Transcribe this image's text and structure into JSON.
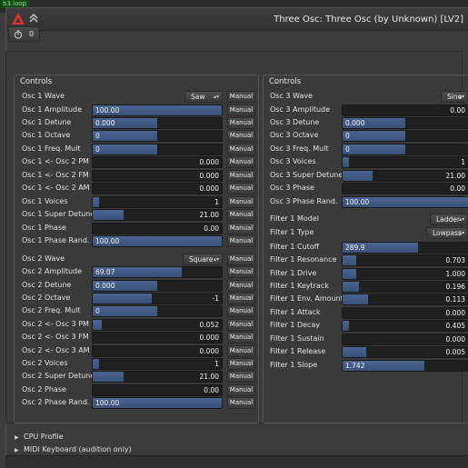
{
  "bg_tab": "b3.loop",
  "window": {
    "title": "Three Osc: Three Osc (by Unknown) [LV2]"
  },
  "preset": {
    "count": "0"
  },
  "panels": {
    "left_title": "Controls",
    "right_title": "Controls"
  },
  "manual_label": "Manual",
  "left": {
    "osc1_wave": {
      "label": "Osc 1 Wave",
      "value": "Saw"
    },
    "osc1_amplitude": {
      "label": "Osc 1 Amplitude",
      "value": "100.00",
      "fraction": 1.0
    },
    "osc1_detune": {
      "label": "Osc 1 Detune",
      "value": "0.000",
      "fraction": 0.5
    },
    "osc1_octave": {
      "label": "Osc 1 Octave",
      "value": "0",
      "fraction": 0.5
    },
    "osc1_freq_mult": {
      "label": "Osc 1 Freq. Mult",
      "value": "0",
      "fraction": 0.5
    },
    "osc1_osc2_pm": {
      "label": "Osc 1 <- Osc 2 PM",
      "value": "0.000",
      "fraction": 0.0
    },
    "osc1_osc2_fm": {
      "label": "Osc 1 <- Osc 2 FM",
      "value": "0.000",
      "fraction": 0.0
    },
    "osc1_osc2_am": {
      "label": "Osc 1 <- Osc 2 AM",
      "value": "0.000",
      "fraction": 0.0
    },
    "osc1_voices": {
      "label": "Osc 1 Voices",
      "value": "1",
      "fraction": 0.05
    },
    "osc1_super_detune": {
      "label": "Osc 1 Super Detune",
      "value": "21.00",
      "fraction": 0.24
    },
    "osc1_phase": {
      "label": "Osc 1 Phase",
      "value": "0.00",
      "fraction": 0.0
    },
    "osc1_phase_rand": {
      "label": "Osc 1 Phase Rand.",
      "value": "100.00",
      "fraction": 1.0
    },
    "osc2_wave": {
      "label": "Osc 2 Wave",
      "value": "Square"
    },
    "osc2_amplitude": {
      "label": "Osc 2 Amplitude",
      "value": "69.07",
      "fraction": 0.69
    },
    "osc2_detune": {
      "label": "Osc 2 Detune",
      "value": "0.000",
      "fraction": 0.5
    },
    "osc2_octave": {
      "label": "Osc 2 Octave",
      "value": "-1",
      "fraction": 0.46
    },
    "osc2_freq_mult": {
      "label": "Osc 2 Freq. Mult",
      "value": "0",
      "fraction": 0.5
    },
    "osc2_osc3_pm": {
      "label": "Osc 2 <- Osc 3 PM",
      "value": "0.052",
      "fraction": 0.07
    },
    "osc2_osc3_fm": {
      "label": "Osc 2 <- Osc 3 FM",
      "value": "0.000",
      "fraction": 0.0
    },
    "osc2_osc3_am": {
      "label": "Osc 2 <- Osc 3 AM",
      "value": "0.000",
      "fraction": 0.0
    },
    "osc2_voices": {
      "label": "Osc 2 Voices",
      "value": "1",
      "fraction": 0.05
    },
    "osc2_super_detune": {
      "label": "Osc 2 Super Detune",
      "value": "21.00",
      "fraction": 0.24
    },
    "osc2_phase": {
      "label": "Osc 2 Phase",
      "value": "0.00",
      "fraction": 0.0
    },
    "osc2_phase_rand": {
      "label": "Osc 2 Phase Rand.",
      "value": "100.00",
      "fraction": 1.0
    }
  },
  "right": {
    "osc3_wave": {
      "label": "Osc 3 Wave",
      "value": "Sine"
    },
    "osc3_amplitude": {
      "label": "Osc 3 Amplitude",
      "value": "0.00",
      "fraction": 0.0
    },
    "osc3_detune": {
      "label": "Osc 3 Detune",
      "value": "0.000",
      "fraction": 0.5
    },
    "osc3_octave": {
      "label": "Osc 3 Octave",
      "value": "0",
      "fraction": 0.5
    },
    "osc3_freq_mult": {
      "label": "Osc 3 Freq. Mult",
      "value": "0",
      "fraction": 0.5
    },
    "osc3_voices": {
      "label": "Osc 3 Voices",
      "value": "1",
      "fraction": 0.05
    },
    "osc3_super_detune": {
      "label": "Osc 3 Super Detune",
      "value": "21.00",
      "fraction": 0.24
    },
    "osc3_phase": {
      "label": "Osc 3 Phase",
      "value": "0.00",
      "fraction": 0.0
    },
    "osc3_phase_rand": {
      "label": "Osc 3 Phase Rand.",
      "value": "100.00",
      "fraction": 1.0
    },
    "filter1_model": {
      "label": "Filter 1 Model",
      "value": "Ladder"
    },
    "filter1_type": {
      "label": "Filter 1 Type",
      "value": "Lowpass"
    },
    "filter1_cutoff": {
      "label": "Filter 1 Cutoff",
      "value": "289.9",
      "fraction": 0.6
    },
    "filter1_resonance": {
      "label": "Filter 1 Resonance",
      "value": "0.703",
      "fraction": 0.11
    },
    "filter1_drive": {
      "label": "Filter 1 Drive",
      "value": "1.000",
      "fraction": 0.11
    },
    "filter1_keytrack": {
      "label": "Filter 1 Keytrack",
      "value": "0.196",
      "fraction": 0.13
    },
    "filter1_env_amount": {
      "label": "Filter 1 Env. Amount",
      "value": "0.113",
      "fraction": 0.2
    },
    "filter1_attack": {
      "label": "Filter 1 Attack",
      "value": "0.000",
      "fraction": 0.0
    },
    "filter1_decay": {
      "label": "Filter 1 Decay",
      "value": "0.405",
      "fraction": 0.05
    },
    "filter1_sustain": {
      "label": "Filter 1 Sustain",
      "value": "0.000",
      "fraction": 0.0
    },
    "filter1_release": {
      "label": "Filter 1 Release",
      "value": "0.005",
      "fraction": 0.19
    },
    "filter1_slope": {
      "label": "Filter 1 Slope",
      "value": "1.742",
      "fraction": 0.65
    }
  },
  "expanders": {
    "cpu_profile": "CPU Profile",
    "midi_keyboard": "MIDI Keyboard (audition only)"
  },
  "colors": {
    "slider_fill": "#3f5a84",
    "slider_trough": "#1f1f1f",
    "window_bg": "#3b3b3b"
  }
}
